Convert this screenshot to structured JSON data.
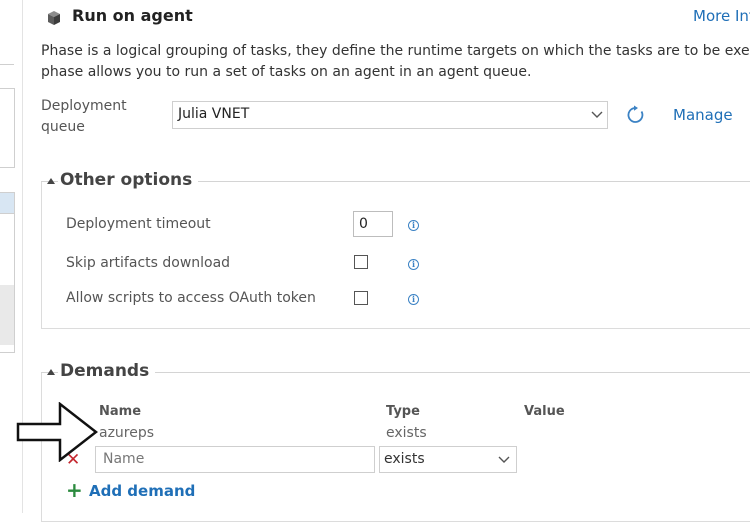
{
  "header": {
    "title": "Run on agent",
    "more_info_link": "More Inf"
  },
  "description": {
    "line1": "Phase is a logical grouping of tasks, they define the runtime targets on which the tasks are to be execute",
    "line2": "phase allows you to run a set of tasks on an agent in an agent queue."
  },
  "deployment_queue": {
    "label_line1": "Deployment",
    "label_line2": "queue",
    "selected": "Julia VNET",
    "manage_label": "Manage"
  },
  "other_options": {
    "title": "Other options",
    "timeout_label": "Deployment timeout",
    "timeout_value": "0",
    "skip_artifacts_label": "Skip artifacts download",
    "skip_artifacts_checked": false,
    "oauth_label": "Allow scripts to access OAuth token",
    "oauth_checked": false
  },
  "demands": {
    "title": "Demands",
    "columns": [
      "Name",
      "Type",
      "Value"
    ],
    "rows": [
      {
        "name": "azureps",
        "type": "exists"
      }
    ],
    "new_row": {
      "name_placeholder": "Name",
      "type_selected": "exists"
    },
    "add_label": "Add demand"
  },
  "colors": {
    "link": "#1f6fb7",
    "delete": "#c4262e",
    "add": "#2b8a3e",
    "info": "#3b82c4"
  },
  "icons": [
    "agent-cube-icon",
    "chevron-down-icon",
    "refresh-icon",
    "collapse-triangle-icon",
    "info-icon",
    "delete-x-icon",
    "plus-icon",
    "callout-arrow-icon"
  ]
}
